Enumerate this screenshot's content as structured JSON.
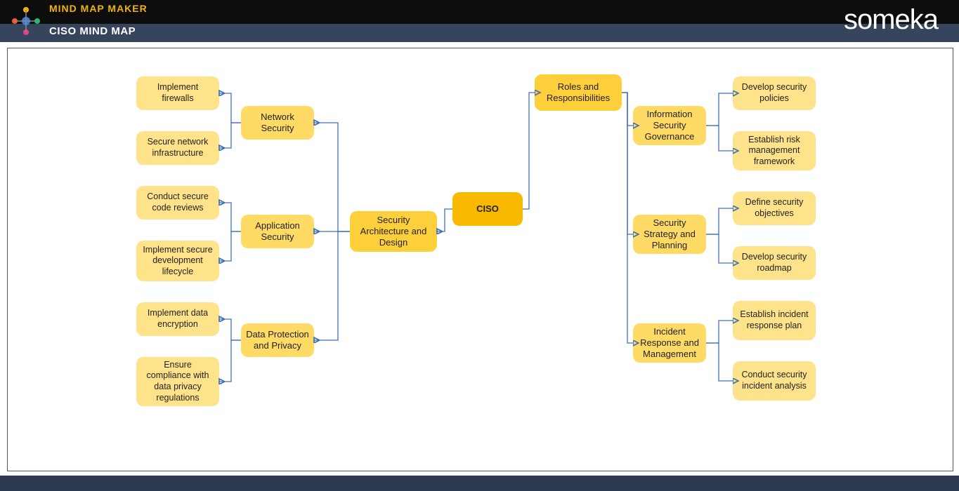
{
  "header": {
    "app": "MIND MAP MAKER",
    "title": "CISO MIND MAP",
    "brand": "someka"
  },
  "root": "CISO",
  "left_cat": "Security Architecture and Design",
  "right_cat": "Roles and Responsibilities",
  "left_subs": [
    "Network Security",
    "Application Security",
    "Data Protection and Privacy"
  ],
  "right_subs": [
    "Information Security Governance",
    "Security Strategy and Planning",
    "Incident Response and Management"
  ],
  "left_leaves": [
    "Implement firewalls",
    "Secure network infrastructure",
    "Conduct secure code reviews",
    "Implement secure development lifecycle",
    "Implement data encryption",
    "Ensure compliance with data privacy regulations"
  ],
  "right_leaves": [
    "Develop security policies",
    "Establish risk management framework",
    "Define security objectives",
    "Develop security roadmap",
    "Establish incident response plan",
    "Conduct security incident analysis"
  ]
}
